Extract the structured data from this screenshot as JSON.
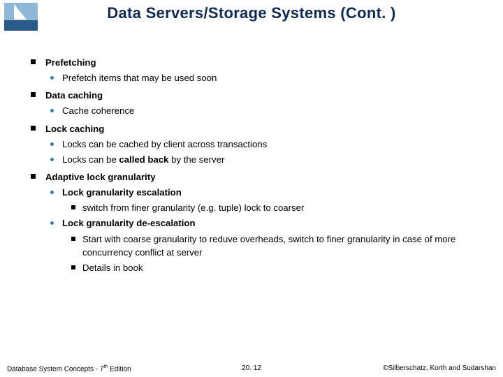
{
  "title": "Data Servers/Storage Systems (Cont. )",
  "b1": {
    "head": "Prefetching",
    "i1": "Prefetch items that may be used soon"
  },
  "b2": {
    "head": "Data caching",
    "i1": "Cache coherence"
  },
  "b3": {
    "head": "Lock caching",
    "i1": "Locks can be cached by client across transactions",
    "i2a": "Locks can be ",
    "i2b": "called back",
    "i2c": " by the server"
  },
  "b4": {
    "head": "Adaptive lock granularity",
    "i1": "Lock granularity escalation",
    "i1s1": "switch from finer granularity (e.g. tuple) lock to coarser",
    "i2": "Lock granularity de-escalation",
    "i2s1": "Start with coarse granularity to reduve overheads, switch to finer granularity in case of more concurrency conflict at server",
    "i2s2": "Details in book"
  },
  "footer": {
    "left_a": "Database System Concepts - 7",
    "left_sup": "th",
    "left_b": " Edition",
    "mid": "20. 12",
    "right": "©Silberschatz, Korth and Sudarshan"
  }
}
